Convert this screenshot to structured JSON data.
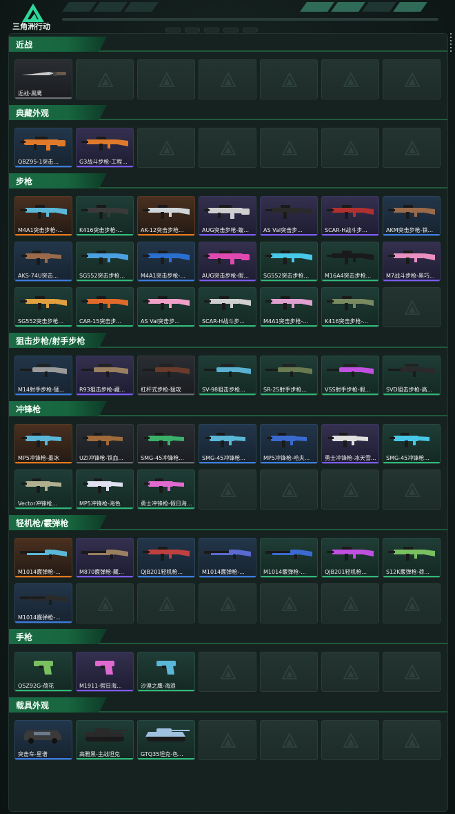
{
  "app": {
    "title": "三角洲行动"
  },
  "colors": {
    "accent": "#1b6b45",
    "purple": "#7a5cff",
    "orange": "#e0781e",
    "blue": "#3b7de0",
    "green": "#2fb877"
  },
  "sections": [
    {
      "title": "近战",
      "rows": [
        [
          {
            "label": "近战-黑鹰",
            "rarity": "gray",
            "gun": "knife"
          },
          null,
          null,
          null,
          null,
          null,
          null
        ]
      ]
    },
    {
      "title": "典藏外观",
      "rows": [
        [
          {
            "label": "QBZ95-1突击...",
            "rarity": "blue",
            "gun": "bullpup",
            "c": "#e07a2a"
          },
          {
            "label": "G3战斗步枪-工程...",
            "rarity": "purple",
            "gun": "rifle",
            "c": "#e07a2a"
          },
          null,
          null,
          null,
          null,
          null
        ]
      ]
    },
    {
      "title": "步枪",
      "rows": [
        [
          {
            "label": "M4A1突击步枪-...",
            "rarity": "orange",
            "gun": "rifle",
            "c": "#5ab7d8"
          },
          {
            "label": "K416突击步枪-...",
            "rarity": "green",
            "gun": "rifle",
            "c": "#3a3a3a"
          },
          {
            "label": "AK-12突击步枪...",
            "rarity": "orange",
            "gun": "rifle",
            "c": "#cfd6da"
          },
          {
            "label": "AUG突击步枪-蝮...",
            "rarity": "purple",
            "gun": "bullpup",
            "c": "#cfcfcf"
          },
          {
            "label": "AS Val突击步...",
            "rarity": "purple",
            "gun": "rifle",
            "c": "#2a2a2a"
          },
          {
            "label": "SCAR-H战斗步...",
            "rarity": "purple",
            "gun": "rifle",
            "c": "#b03030"
          },
          {
            "label": "AKM突击步枪-铁...",
            "rarity": "blue",
            "gun": "rifle",
            "c": "#9a6a4a"
          }
        ],
        [
          {
            "label": "AKS-74U突击...",
            "rarity": "blue",
            "gun": "smg",
            "c": "#9a6a4a"
          },
          {
            "label": "SG552突击步枪...",
            "rarity": "green",
            "gun": "rifle",
            "c": "#4aa0e0"
          },
          {
            "label": "M4A1突击步枪-...",
            "rarity": "blue",
            "gun": "rifle",
            "c": "#2a6fd0"
          },
          {
            "label": "AUG突击步枪-假...",
            "rarity": "purple",
            "gun": "bullpup",
            "c": "#e04ab0"
          },
          {
            "label": "SG552突击步枪...",
            "rarity": "green",
            "gun": "rifle",
            "c": "#48c8e8"
          },
          {
            "label": "M16A4突击步枪...",
            "rarity": "green",
            "gun": "rifle",
            "c": "#1a1a1a"
          },
          {
            "label": "M7战斗步枪-黑巧...",
            "rarity": "purple",
            "gun": "rifle",
            "c": "#e890c0"
          }
        ],
        [
          {
            "label": "SG552突击步枪...",
            "rarity": "green",
            "gun": "rifle",
            "c": "#e0a040"
          },
          {
            "label": "CAR-15突击步...",
            "rarity": "green",
            "gun": "rifle",
            "c": "#e06a2a"
          },
          {
            "label": "AS Val突击步...",
            "rarity": "green",
            "gun": "rifle",
            "c": "#f0a0c8"
          },
          {
            "label": "SCAR-H战斗步...",
            "rarity": "green",
            "gun": "rifle",
            "c": "#cfcfcf"
          },
          {
            "label": "M4A1突击步枪-...",
            "rarity": "green",
            "gun": "rifle",
            "c": "#e0a0d0"
          },
          {
            "label": "K416突击步枪-...",
            "rarity": "green",
            "gun": "rifle",
            "c": "#7a8a60"
          },
          null
        ]
      ]
    },
    {
      "title": "狙击步枪/射手步枪",
      "rows": [
        [
          {
            "label": "M14射手步枪-猛...",
            "rarity": "blue",
            "gun": "sniper",
            "c": "#9a9a9a"
          },
          {
            "label": "R93狙击步枪-藏...",
            "rarity": "purple",
            "gun": "sniper",
            "c": "#9a8060"
          },
          {
            "label": "杠杆式步枪-猛攻",
            "rarity": "gray",
            "gun": "sniper",
            "c": "#6a3a2a"
          },
          {
            "label": "SV-98狙击步枪...",
            "rarity": "green",
            "gun": "sniper",
            "c": "#5ab0d0"
          },
          {
            "label": "SR-25射手步枪...",
            "rarity": "green",
            "gun": "sniper",
            "c": "#6a7a50"
          },
          {
            "label": "VSS射手步枪-假...",
            "rarity": "green",
            "gun": "sniper",
            "c": "#c050e0"
          },
          {
            "label": "SVD狙击步枪-高...",
            "rarity": "green",
            "gun": "sniper",
            "c": "#2a2a2a"
          }
        ]
      ]
    },
    {
      "title": "冲锋枪",
      "rows": [
        [
          {
            "label": "MP5冲锋枪-墨冰",
            "rarity": "orange",
            "gun": "smg",
            "c": "#5ab7d8"
          },
          {
            "label": "UZI冲锋枪-铁血...",
            "rarity": "gray",
            "gun": "smg",
            "c": "#a06a3a"
          },
          {
            "label": "SMG-45冲锋枪...",
            "rarity": "gray",
            "gun": "smg",
            "c": "#3ab06a"
          },
          {
            "label": "SMG-45冲锋枪...",
            "rarity": "blue",
            "gun": "smg",
            "c": "#5ab7d8"
          },
          {
            "label": "MP5冲锋枪-哈夫...",
            "rarity": "blue",
            "gun": "smg",
            "c": "#3a6ad0"
          },
          {
            "label": "勇士冲锋枪-冰天雪...",
            "rarity": "purple",
            "gun": "smg",
            "c": "#e0e0e0"
          },
          {
            "label": "SMG-45冲锋枪...",
            "rarity": "green",
            "gun": "smg",
            "c": "#48c8e8"
          }
        ],
        [
          {
            "label": "Vector冲锋枪...",
            "rarity": "green",
            "gun": "smg",
            "c": "#b0b090"
          },
          {
            "label": "MP5冲锋枪-海色",
            "rarity": "green",
            "gun": "smg",
            "c": "#e0e0f0"
          },
          {
            "label": "勇士冲锋枪-假日海...",
            "rarity": "green",
            "gun": "smg",
            "c": "#e06ad0"
          },
          null,
          null,
          null,
          null
        ]
      ]
    },
    {
      "title": "轻机枪/霰弹枪",
      "rows": [
        [
          {
            "label": "M1014霰弹枪-...",
            "rarity": "orange",
            "gun": "shotgun",
            "c": "#5ab7d8"
          },
          {
            "label": "M870霰弹枪-藏...",
            "rarity": "purple",
            "gun": "shotgun",
            "c": "#9a8060"
          },
          {
            "label": "QJB201轻机枪...",
            "rarity": "blue",
            "gun": "rifle",
            "c": "#c04040"
          },
          {
            "label": "M1014霰弹枪-...",
            "rarity": "blue",
            "gun": "shotgun",
            "c": "#5a6ad0"
          },
          {
            "label": "M1014霰弹枪-...",
            "rarity": "green",
            "gun": "shotgun",
            "c": "#3a6ad0"
          },
          {
            "label": "QJB201轻机枪...",
            "rarity": "green",
            "gun": "rifle",
            "c": "#c050e0"
          },
          {
            "label": "S12K霰弹枪-荷...",
            "rarity": "green",
            "gun": "rifle",
            "c": "#7ac060"
          }
        ],
        [
          {
            "label": "M1014霰弹枪-...",
            "rarity": "blue",
            "gun": "shotgun",
            "c": "#2a2a2a"
          },
          null,
          null,
          null,
          null,
          null,
          null
        ]
      ]
    },
    {
      "title": "手枪",
      "rows": [
        [
          {
            "label": "QSZ92G-荷花",
            "rarity": "green",
            "gun": "pistol",
            "c": "#7ac060"
          },
          {
            "label": "M1911-假日海...",
            "rarity": "purple",
            "gun": "pistol",
            "c": "#e06ad0"
          },
          {
            "label": "沙漠之鹰-海浪",
            "rarity": "green",
            "gun": "pistol",
            "c": "#5ab7d8"
          },
          null,
          null,
          null,
          null
        ]
      ]
    },
    {
      "title": "载具外观",
      "rows": [
        [
          {
            "label": "突击车-星谱",
            "rarity": "blue",
            "gun": "car",
            "c": "#3a3a3a"
          },
          {
            "label": "高雅黑-主战坦克",
            "rarity": "green",
            "gun": "tank",
            "c": "#2a2a2a"
          },
          {
            "label": "GTQ35坦克-色...",
            "rarity": "green",
            "gun": "tank",
            "c": "#a0c0e0"
          },
          null,
          null,
          null,
          null
        ]
      ]
    }
  ]
}
